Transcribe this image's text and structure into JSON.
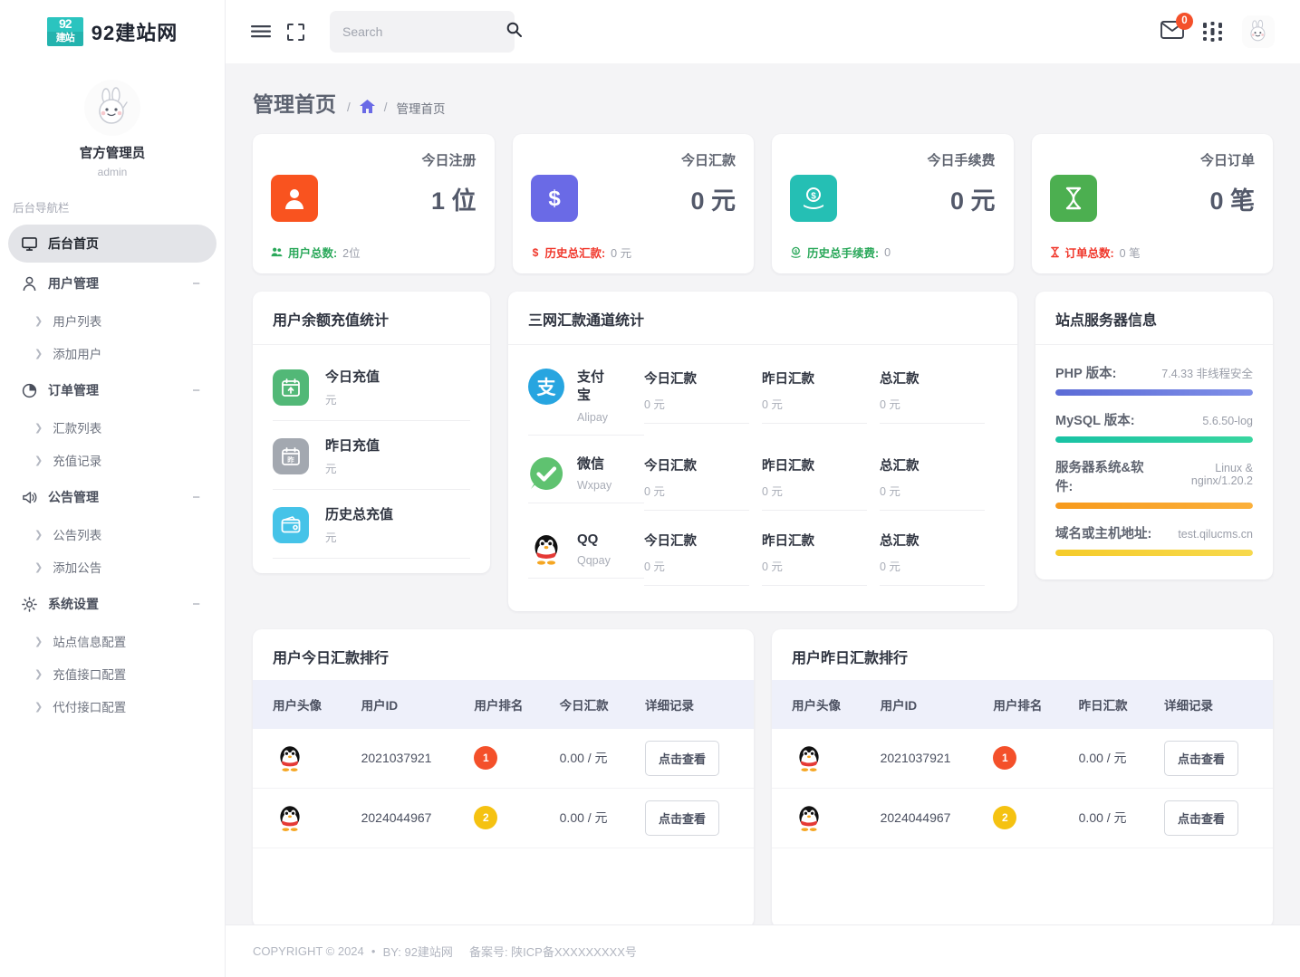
{
  "brand": {
    "logo_line1": "92",
    "logo_line2": "建站",
    "name": "92建站网"
  },
  "profile": {
    "name": "官方管理员",
    "role": "admin",
    "avatar_icon": "rabbit-avatar"
  },
  "sidebar": {
    "nav_title": "后台导航栏",
    "groups": [
      {
        "label": "后台首页",
        "icon": "monitor-icon",
        "active": true,
        "collapse": "",
        "children": []
      },
      {
        "label": "用户管理",
        "icon": "user-icon",
        "active": false,
        "collapse": "−",
        "children": [
          {
            "label": "用户列表"
          },
          {
            "label": "添加用户"
          }
        ]
      },
      {
        "label": "订单管理",
        "icon": "pie-chart-icon",
        "active": false,
        "collapse": "−",
        "children": [
          {
            "label": "汇款列表"
          },
          {
            "label": "充值记录"
          }
        ]
      },
      {
        "label": "公告管理",
        "icon": "megaphone-icon",
        "active": false,
        "collapse": "−",
        "children": [
          {
            "label": "公告列表"
          },
          {
            "label": "添加公告"
          }
        ]
      },
      {
        "label": "系统设置",
        "icon": "gear-icon",
        "active": false,
        "collapse": "−",
        "children": [
          {
            "label": "站点信息配置"
          },
          {
            "label": "充值接口配置"
          },
          {
            "label": "代付接口配置"
          }
        ]
      }
    ]
  },
  "topbar": {
    "menu_icon": "hamburger-icon",
    "fullscreen_icon": "fullscreen-icon",
    "search": {
      "placeholder": "Search",
      "value": "",
      "icon": "search-icon"
    },
    "mail": {
      "icon": "envelope-icon",
      "badge": "0"
    },
    "apps_icon": "apps-grid-icon",
    "avatar_icon": "rabbit-avatar"
  },
  "page": {
    "title": "管理首页",
    "breadcrumb": {
      "sep": "/",
      "home_icon": "home-icon",
      "current": "管理首页"
    }
  },
  "stats": [
    {
      "label": "今日注册",
      "value": "1 位",
      "icon": "user-solid-icon",
      "icon_color": "#f9531f",
      "foot_icon": "users-icon",
      "foot_label": "用户总数:",
      "foot_label_color": "#2aa85a",
      "foot_value": "2位"
    },
    {
      "label": "今日汇款",
      "value": "0 元",
      "icon": "dollar-icon",
      "icon_color": "#6a6ae6",
      "foot_icon": "dollar-small-icon",
      "foot_label": "历史总汇款:",
      "foot_label_color": "#f0372b",
      "foot_value": "0 元"
    },
    {
      "label": "今日手续费",
      "value": "0 元",
      "icon": "coin-stack-icon",
      "icon_color": "#25bfb4",
      "foot_icon": "coin-small-icon",
      "foot_label": "历史总手续费:",
      "foot_label_color": "#2aa85a",
      "foot_value": "0"
    },
    {
      "label": "今日订单",
      "value": "0 笔",
      "icon": "hourglass-icon",
      "icon_color": "#4caf50",
      "foot_icon": "hourglass-small-icon",
      "foot_label": "订单总数:",
      "foot_label_color": "#f0372b",
      "foot_value": "0 笔"
    }
  ],
  "balance_panel": {
    "title": "用户余额充值统计",
    "rows": [
      {
        "label": "今日充值",
        "value": "元",
        "icon": "calendar-today-icon",
        "icon_color": "#52b877"
      },
      {
        "label": "昨日充值",
        "value": "元",
        "icon": "calendar-yesterday-icon",
        "icon_color": "#a3a8b0"
      },
      {
        "label": "历史总充值",
        "value": "元",
        "icon": "wallet-icon",
        "icon_color": "#45c3e8"
      }
    ]
  },
  "channel_panel": {
    "title": "三网汇款通道统计",
    "columns": [
      "今日汇款",
      "昨日汇款",
      "总汇款"
    ],
    "rows": [
      {
        "name": "支付宝",
        "sub": "Alipay",
        "icon": "alipay-icon",
        "icon_color": "#27a5e0",
        "values": [
          "0 元",
          "0 元",
          "0 元"
        ]
      },
      {
        "name": "微信",
        "sub": "Wxpay",
        "icon": "wechat-icon",
        "icon_color": "#5fc270",
        "values": [
          "0 元",
          "0 元",
          "0 元"
        ]
      },
      {
        "name": "QQ",
        "sub": "Qqpay",
        "icon": "qq-penguin-icon",
        "icon_color": "#2b2b2b",
        "values": [
          "0 元",
          "0 元",
          "0 元"
        ]
      }
    ]
  },
  "server_panel": {
    "title": "站点服务器信息",
    "items": [
      {
        "key": "PHP 版本:",
        "value": "7.4.33 非线程安全",
        "percent": 100,
        "color": "#5b6bd6",
        "color2": "#7f8fe8"
      },
      {
        "key": "MySQL 版本:",
        "value": "5.6.50-log",
        "percent": 100,
        "color": "#18c2a4",
        "color2": "#39d6a0"
      },
      {
        "key": "服务器系统&软件:",
        "value": "Linux & nginx/1.20.2",
        "percent": 100,
        "color": "#f79a1c",
        "color2": "#fbb03b"
      },
      {
        "key": "域名或主机地址:",
        "value": "test.qilucms.cn",
        "percent": 100,
        "color": "#f5cb2a",
        "color2": "#f7d94d"
      }
    ]
  },
  "rank_today": {
    "title": "用户今日汇款排行",
    "columns": [
      "用户头像",
      "用户ID",
      "用户排名",
      "今日汇款",
      "详细记录"
    ],
    "rows": [
      {
        "avatar": "qq-penguin-icon",
        "user_id": "2021037921",
        "rank": "1",
        "rank_color": "#f4502a",
        "amount": "0.00 / 元",
        "action": "点击查看"
      },
      {
        "avatar": "qq-penguin-icon",
        "user_id": "2024044967",
        "rank": "2",
        "rank_color": "#f5c211",
        "amount": "0.00 / 元",
        "action": "点击查看"
      }
    ]
  },
  "rank_yesterday": {
    "title": "用户昨日汇款排行",
    "columns": [
      "用户头像",
      "用户ID",
      "用户排名",
      "昨日汇款",
      "详细记录"
    ],
    "rows": [
      {
        "avatar": "qq-penguin-icon",
        "user_id": "2021037921",
        "rank": "1",
        "rank_color": "#f4502a",
        "amount": "0.00 / 元",
        "action": "点击查看"
      },
      {
        "avatar": "qq-penguin-icon",
        "user_id": "2024044967",
        "rank": "2",
        "rank_color": "#f5c211",
        "amount": "0.00 / 元",
        "action": "点击查看"
      }
    ]
  },
  "footer": {
    "copyright": "COPYRIGHT © 2024",
    "dot": "●",
    "by": "BY: 92建站网",
    "icp": "备案号: 陕ICP备XXXXXXXXX号"
  }
}
